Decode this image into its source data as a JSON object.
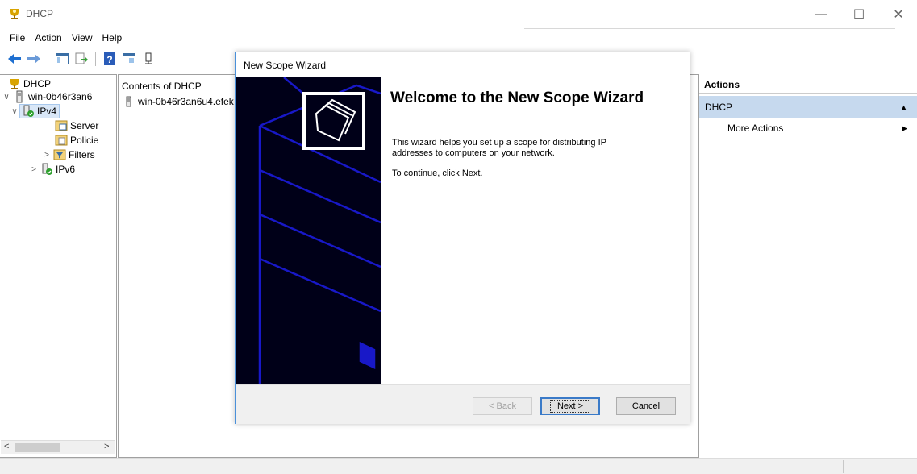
{
  "window": {
    "title": "DHCP",
    "minimize": "—",
    "maximize": "☐",
    "close": "✕"
  },
  "menu": [
    "File",
    "Action",
    "View",
    "Help"
  ],
  "toolbar": {
    "icons": [
      "back-arrow-icon",
      "forward-arrow-icon",
      "show-hide-tree-icon",
      "export-list-icon",
      "help-icon",
      "properties-icon",
      "server-icon"
    ]
  },
  "tree": {
    "root": "DHCP",
    "server": "win-0b46r3an6",
    "ipv4": "IPv4",
    "server_options": "Server",
    "policies": "Policie",
    "filters": "Filters",
    "ipv6": "IPv6"
  },
  "content": {
    "title": "Contents of DHCP",
    "row": "win-0b46r3an6u4.efek"
  },
  "actions": {
    "header": "Actions",
    "group": "DHCP",
    "more": "More Actions"
  },
  "wizard": {
    "title": "New Scope Wizard",
    "heading": "Welcome to the New Scope Wizard",
    "body1": "This wizard helps you set up a scope for distributing IP addresses to computers on your network.",
    "body2": "To continue, click Next.",
    "back": "< Back",
    "next": "Next >",
    "cancel": "Cancel"
  },
  "colors": {
    "banner": "#000018",
    "banner_lines": "#1818c8",
    "selection": "#c6d9ee",
    "dialog_border": "#4a90d9"
  }
}
